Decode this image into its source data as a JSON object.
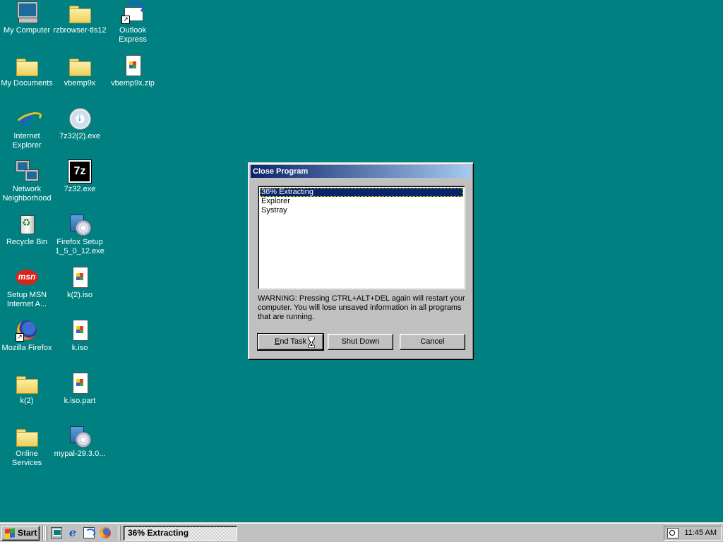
{
  "desktop": {
    "icons": [
      {
        "label": "My Computer",
        "icon": "computer-icon"
      },
      {
        "label": "rzbrowser-tls12",
        "icon": "folder-icon"
      },
      {
        "label": "Outlook\nExpress",
        "icon": "outlook-express-icon"
      },
      {
        "label": "My Documents",
        "icon": "my-documents-icon"
      },
      {
        "label": "vbemp9x",
        "icon": "folder-icon"
      },
      {
        "label": "vbemp9x.zip",
        "icon": "zip-file-icon"
      },
      {
        "label": "Internet\nExplorer",
        "icon": "internet-explorer-icon"
      },
      {
        "label": "7z32(2).exe",
        "icon": "installer-icon"
      },
      {
        "label": "Network\nNeighborhood",
        "icon": "network-icon"
      },
      {
        "label": "7z32.exe",
        "icon": "7zip-icon"
      },
      {
        "label": "Recycle Bin",
        "icon": "recycle-bin-icon"
      },
      {
        "label": "Firefox Setup\n1_5_0_12.exe",
        "icon": "setup-disc-icon"
      },
      {
        "label": "Setup MSN\nInternet A...",
        "icon": "msn-icon"
      },
      {
        "label": "k(2).iso",
        "icon": "iso-file-icon"
      },
      {
        "label": "Mozilla Firefox",
        "icon": "firefox-icon"
      },
      {
        "label": "k.iso",
        "icon": "iso-file-icon"
      },
      {
        "label": "k(2)",
        "icon": "folder-icon"
      },
      {
        "label": "k.iso.part",
        "icon": "file-icon"
      },
      {
        "label": "Online\nServices",
        "icon": "folder-icon"
      },
      {
        "label": "mypal-29.3.0...",
        "icon": "setup-disc-icon"
      }
    ]
  },
  "dialog": {
    "title": "Close Program",
    "programs": [
      "36% Extracting",
      "Explorer",
      "Systray"
    ],
    "selected_index": 0,
    "warning": "WARNING: Pressing CTRL+ALT+DEL again will restart your computer. You will lose unsaved information in all programs that are running.",
    "buttons": {
      "end_task": "End Task",
      "shut_down": "Shut Down",
      "cancel": "Cancel"
    }
  },
  "taskbar": {
    "start_label": "Start",
    "task_label": "36% Extracting",
    "clock": "11:45 AM"
  },
  "colors": {
    "desktop": "#008080",
    "titlebar_start": "#0a246a",
    "titlebar_end": "#a6caf0",
    "selection": "#0a246a"
  }
}
